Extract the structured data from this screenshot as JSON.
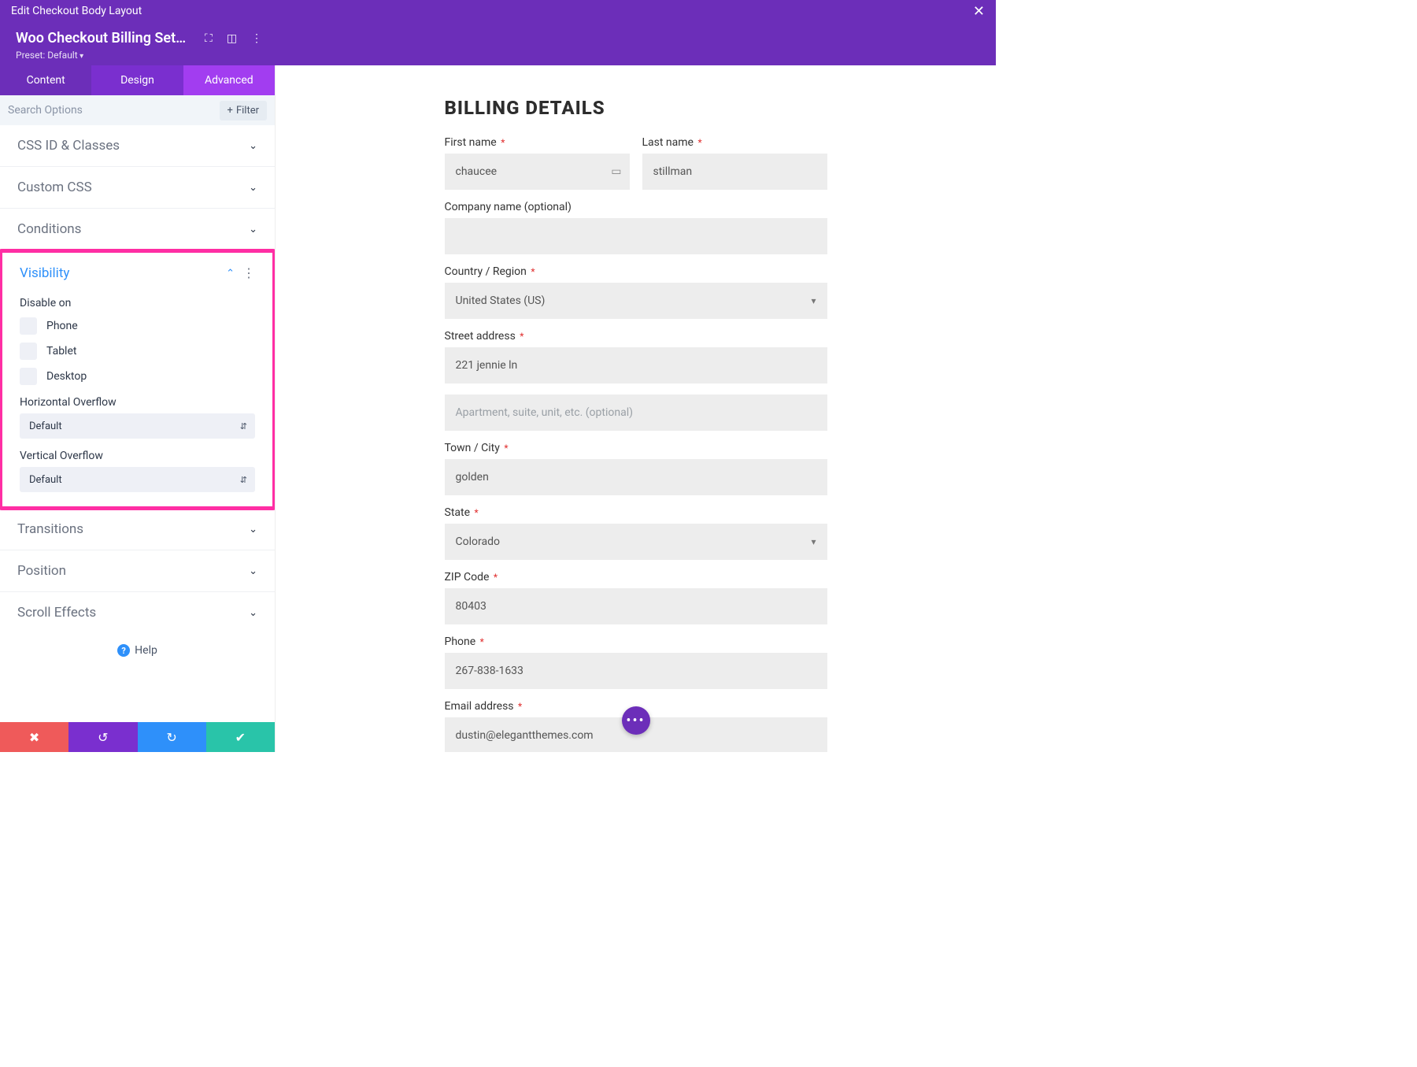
{
  "title_bar": {
    "title": "Edit Checkout Body Layout"
  },
  "module": {
    "title": "Woo Checkout Billing Setti...",
    "preset": "Preset: Default"
  },
  "tabs": {
    "content": "Content",
    "design": "Design",
    "advanced": "Advanced"
  },
  "search": {
    "placeholder": "Search Options",
    "filter": "Filter"
  },
  "accordion": {
    "css_id": "CSS ID & Classes",
    "custom_css": "Custom CSS",
    "conditions": "Conditions",
    "visibility": {
      "title": "Visibility",
      "disable_on": "Disable on",
      "phone": "Phone",
      "tablet": "Tablet",
      "desktop": "Desktop",
      "h_overflow_label": "Horizontal Overflow",
      "h_overflow_value": "Default",
      "v_overflow_label": "Vertical Overflow",
      "v_overflow_value": "Default"
    },
    "transitions": "Transitions",
    "position": "Position",
    "scroll_effects": "Scroll Effects"
  },
  "help": "Help",
  "billing": {
    "heading": "BILLING DETAILS",
    "first_name_label": "First name",
    "first_name_value": "chaucee",
    "last_name_label": "Last name",
    "last_name_value": "stillman",
    "company_label": "Company name (optional)",
    "country_label": "Country / Region",
    "country_value": "United States (US)",
    "street_label": "Street address",
    "street_value": "221 jennie ln",
    "street2_placeholder": "Apartment, suite, unit, etc. (optional)",
    "city_label": "Town / City",
    "city_value": "golden",
    "state_label": "State",
    "state_value": "Colorado",
    "zip_label": "ZIP Code",
    "zip_value": "80403",
    "phone_label": "Phone",
    "phone_value": "267-838-1633",
    "email_label": "Email address",
    "email_value": "dustin@elegantthemes.com"
  }
}
